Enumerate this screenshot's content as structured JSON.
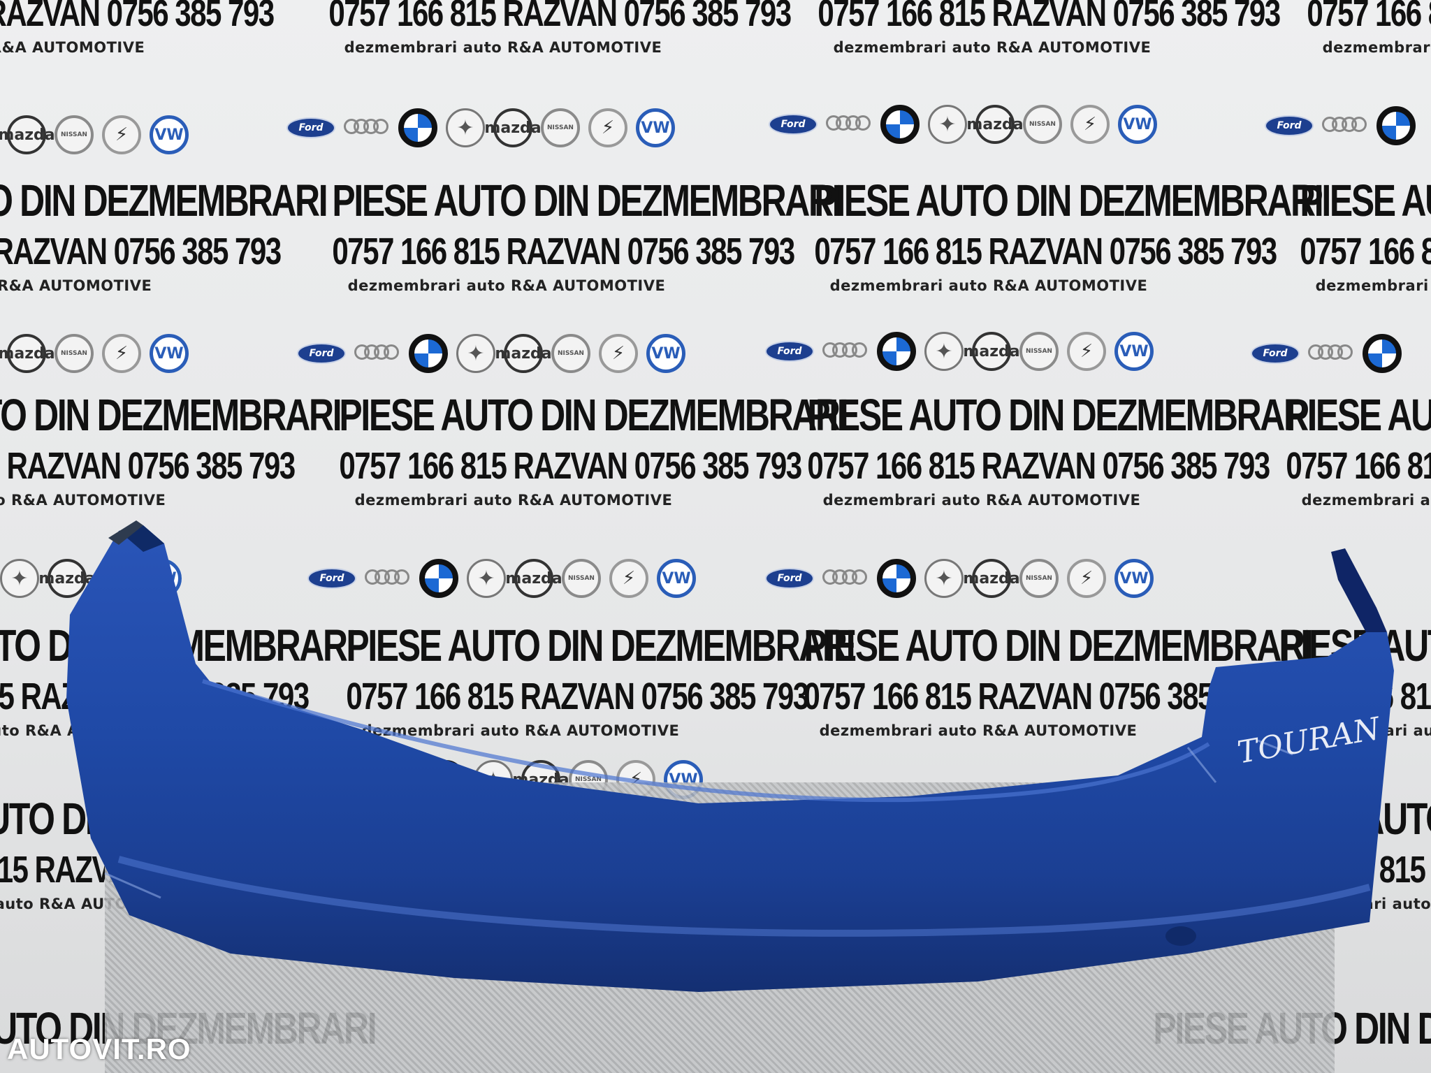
{
  "poster": {
    "headline": "PIESE AUTO DIN DEZMEMBRARI",
    "phones": "0757 166 815 RAZVAN  0756 385 793",
    "tagline": "dezmembrari auto R&A AUTOMOTIVE",
    "logos": [
      {
        "icon": "ford-logo-icon",
        "text": "Ford"
      },
      {
        "icon": "audi-logo-icon",
        "text": "Audi"
      },
      {
        "icon": "bmw-logo-icon",
        "text": "BMW"
      },
      {
        "icon": "mercedes-logo-icon",
        "text": "✦"
      },
      {
        "icon": "mazda-logo-icon",
        "text": "mazda"
      },
      {
        "icon": "nissan-logo-icon",
        "text": "NISSAN"
      },
      {
        "icon": "opel-logo-icon",
        "text": "⚡"
      },
      {
        "icon": "vw-logo-icon",
        "text": "VW"
      }
    ]
  },
  "part": {
    "handwritten_label": "TOURAN",
    "color": "#1f49a6",
    "color_dark": "#15337a",
    "color_light": "#3b64c2"
  },
  "watermark": "AUTOVIT.RO"
}
